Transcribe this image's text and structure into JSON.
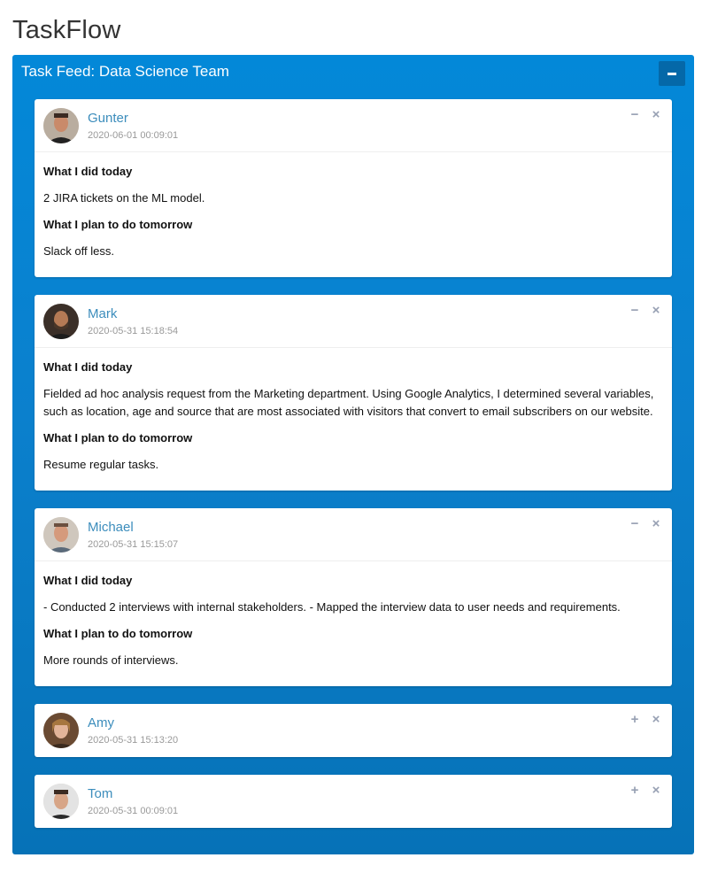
{
  "app": {
    "title": "TaskFlow"
  },
  "feed": {
    "title": "Task Feed: Data Science Team",
    "collapse_icon": "minus-icon",
    "posts": [
      {
        "name": "Gunter",
        "date": "2020-06-01 00:09:01",
        "expanded": true,
        "did_label": "What I did today",
        "did_text": "2 JIRA tickets on the ML model.",
        "plan_label": "What I plan to do tomorrow",
        "plan_text": "Slack off less."
      },
      {
        "name": "Mark",
        "date": "2020-05-31 15:18:54",
        "expanded": true,
        "did_label": "What I did today",
        "did_text": "Fielded ad hoc analysis request from the Marketing department. Using Google Analytics, I determined several variables, such as location, age and source that are most associated with visitors that convert to email subscribers on our website.",
        "plan_label": "What I plan to do tomorrow",
        "plan_text": "Resume regular tasks."
      },
      {
        "name": "Michael",
        "date": "2020-05-31 15:15:07",
        "expanded": true,
        "did_label": "What I did today",
        "did_text": "- Conducted 2 interviews with internal stakeholders. - Mapped the interview data to user needs and requirements.",
        "plan_label": "What I plan to do tomorrow",
        "plan_text": "More rounds of interviews."
      },
      {
        "name": "Amy",
        "date": "2020-05-31 15:13:20",
        "expanded": false
      },
      {
        "name": "Tom",
        "date": "2020-05-31 00:09:01",
        "expanded": false
      }
    ]
  },
  "icons": {
    "collapse": "−",
    "expand": "+",
    "remove": "×"
  },
  "colors": {
    "panel": "#0388d8",
    "username": "#3c8dbc",
    "tool": "#97a0b3"
  }
}
